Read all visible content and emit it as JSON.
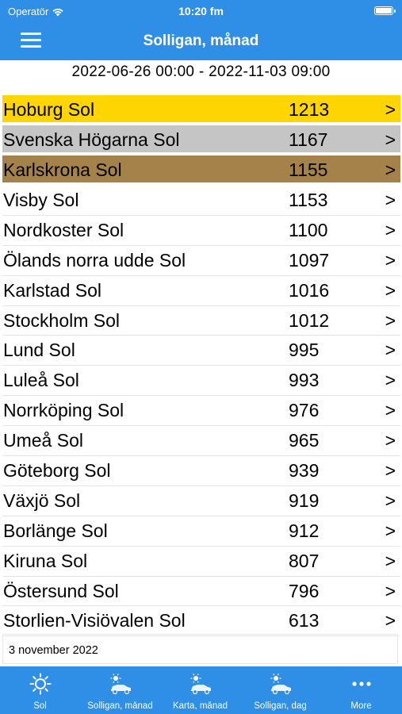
{
  "status_bar": {
    "carrier": "Operatör",
    "time": "10:20 fm"
  },
  "header": {
    "title": "Solligan, månad"
  },
  "date_range": "2022-06-26 00:00  -  2022-11-03 09:00",
  "colors": {
    "gold": "#ffd500",
    "silver": "#c5c5c5",
    "bronze": "#a6824b",
    "accent": "#2f8ee6"
  },
  "ranking": [
    {
      "name": "Hoburg Sol",
      "value": "1213",
      "arrow": ">"
    },
    {
      "name": "Svenska Högarna Sol",
      "value": "1167",
      "arrow": ">"
    },
    {
      "name": "Karlskrona Sol",
      "value": "1155",
      "arrow": ">"
    },
    {
      "name": "Visby Sol",
      "value": "1153",
      "arrow": ">"
    },
    {
      "name": "Nordkoster Sol",
      "value": "1100",
      "arrow": ">"
    },
    {
      "name": "Ölands norra udde Sol",
      "value": "1097",
      "arrow": ">"
    },
    {
      "name": "Karlstad Sol",
      "value": "1016",
      "arrow": ">"
    },
    {
      "name": "Stockholm Sol",
      "value": "1012",
      "arrow": ">"
    },
    {
      "name": "Lund Sol",
      "value": "995",
      "arrow": ">"
    },
    {
      "name": "Luleå Sol",
      "value": "993",
      "arrow": ">"
    },
    {
      "name": "Norrköping Sol",
      "value": "976",
      "arrow": ">"
    },
    {
      "name": "Umeå Sol",
      "value": "965",
      "arrow": ">"
    },
    {
      "name": "Göteborg Sol",
      "value": "939",
      "arrow": ">"
    },
    {
      "name": "Växjö Sol",
      "value": "919",
      "arrow": ">"
    },
    {
      "name": "Borlänge Sol",
      "value": "912",
      "arrow": ">"
    },
    {
      "name": "Kiruna Sol",
      "value": "807",
      "arrow": ">"
    },
    {
      "name": "Östersund Sol",
      "value": "796",
      "arrow": ">"
    },
    {
      "name": "Storlien-Visiövalen Sol",
      "value": "613",
      "arrow": ">"
    }
  ],
  "footer_date": "3 november 2022",
  "tabs": [
    {
      "label": "Sol",
      "icon": "sun-icon"
    },
    {
      "label": "Solligan, månad",
      "icon": "sun-car-icon"
    },
    {
      "label": "Karta, månad",
      "icon": "sun-car-icon"
    },
    {
      "label": "Solligan, dag",
      "icon": "sun-car-icon"
    },
    {
      "label": "More",
      "icon": "more-icon"
    }
  ]
}
